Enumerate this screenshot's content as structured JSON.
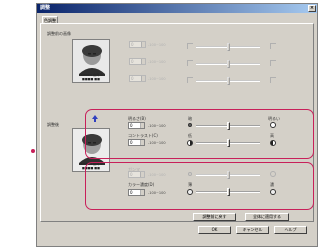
{
  "window": {
    "title": "調整",
    "close_glyph": "×"
  },
  "tab": {
    "label": "色調整"
  },
  "sections": {
    "original_label": "調整前の画像",
    "adjusted_label": "調整後"
  },
  "previews": {
    "before_caption_1": "MOTHER 台湾 ©",
    "before_caption_2": "■■■■ ■■",
    "after_caption_1": "MOTHER 台湾 ©",
    "after_caption_2": "■■■■ ■■"
  },
  "top_controls": [
    {
      "label": "",
      "value": "0",
      "range": "-100~100"
    },
    {
      "label": "",
      "value": "0",
      "range": "-100~100"
    },
    {
      "label": "",
      "value": "0",
      "range": "-100~100"
    }
  ],
  "group1": {
    "brightness": {
      "label": "明るさ(B)",
      "value": "0",
      "range": "-100~100",
      "left": "暗",
      "right": "明るい"
    },
    "contrast": {
      "label": "コントラスト(C)",
      "value": "0",
      "range": "-100~100",
      "left": "低",
      "right": "高"
    }
  },
  "group2": {
    "gamma": {
      "label": "ガンマ",
      "value": "0",
      "range": "-100~100",
      "left": "",
      "right": ""
    },
    "color_depth": {
      "label": "カラー濃度(D)",
      "value": "0",
      "range": "-100~100",
      "left": "薄",
      "right": "濃"
    }
  },
  "buttons": {
    "reset": "調整前に戻す",
    "apply_all": "全体に適用する",
    "ok": "OK",
    "cancel": "キャンセル",
    "help": "ヘルプ"
  },
  "colors": {
    "highlight": "#c8205a",
    "arrow": "#3040c0"
  }
}
